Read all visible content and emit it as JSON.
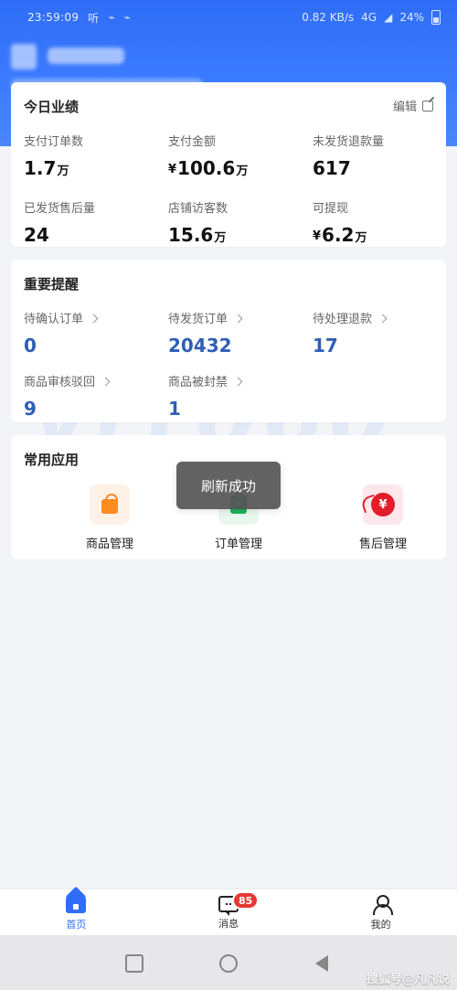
{
  "status_bar": {
    "time": "23:59:09",
    "left_icons": [
      "听",
      "⌁",
      "⌁"
    ],
    "right_text": "0.82 KB/s",
    "network": "4G",
    "battery_percent": "24%"
  },
  "today_performance": {
    "title": "今日业绩",
    "action_label": "编辑",
    "metrics": [
      {
        "label": "支付订单数",
        "value": "1.7",
        "unit": "万"
      },
      {
        "label": "支付金额",
        "prefix": "¥",
        "value": "100.6",
        "unit": "万"
      },
      {
        "label": "未发货退款量",
        "value": "617"
      },
      {
        "label": "已发货售后量",
        "value": "24"
      },
      {
        "label": "店铺访客数",
        "value": "15.6",
        "unit": "万"
      },
      {
        "label": "可提现",
        "prefix": "¥",
        "value": "6.2",
        "unit": "万"
      }
    ]
  },
  "important_reminders": {
    "title": "重要提醒",
    "items": [
      {
        "label": "待确认订单",
        "value": "0"
      },
      {
        "label": "待发货订单",
        "value": "20432"
      },
      {
        "label": "待处理退款",
        "value": "17"
      },
      {
        "label": "商品审核驳回",
        "value": "9"
      },
      {
        "label": "商品被封禁",
        "value": "1"
      }
    ]
  },
  "common_apps": {
    "title": "常用应用",
    "apps": [
      {
        "label": "商品管理",
        "icon": "shopping-bag-icon",
        "bg": "#fff1e6"
      },
      {
        "label": "订单管理",
        "icon": "clipboard-icon",
        "bg": "#e9f8ee"
      },
      {
        "label": "售后管理",
        "icon": "after-sales-icon",
        "bg": "#fde7ea"
      }
    ]
  },
  "toast": {
    "text": "刷新成功"
  },
  "bottom_nav": {
    "items": [
      {
        "label": "首页",
        "active": true
      },
      {
        "label": "消息",
        "badge": "85"
      },
      {
        "label": "我的"
      }
    ]
  },
  "watermark_text": "yi1060",
  "sohu_watermark": "搜狐号@凡凡说",
  "colors": {
    "brand_blue": "#2f6df6",
    "value_blue": "#2f5fb5",
    "badge_red": "#e53935"
  }
}
